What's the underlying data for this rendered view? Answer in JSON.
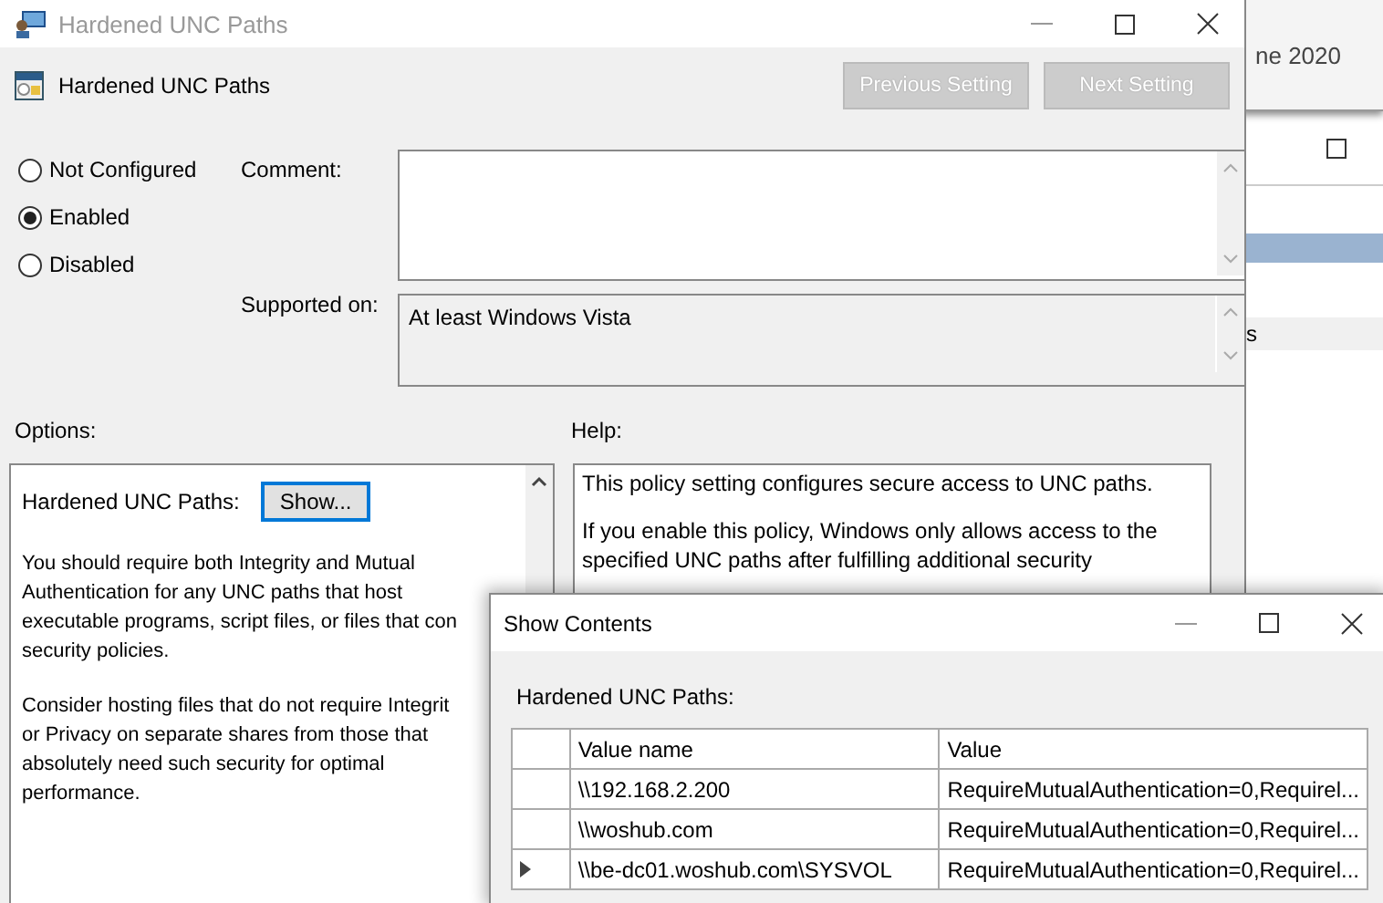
{
  "background_window": {
    "date_text": "ne 2020",
    "side_text": "s"
  },
  "window": {
    "title": "Hardened UNC Paths"
  },
  "header": {
    "title": "Hardened UNC Paths",
    "buttons": [
      {
        "label": "Previous Setting",
        "disabled": true
      },
      {
        "label": "Next Setting",
        "disabled": true
      }
    ]
  },
  "state_options": [
    {
      "label": "Not Configured",
      "selected": false
    },
    {
      "label": "Enabled",
      "selected": true
    },
    {
      "label": "Disabled",
      "selected": false
    }
  ],
  "comment": {
    "label": "Comment:"
  },
  "supported_on": {
    "label": "Supported on:",
    "value": "At least Windows Vista"
  },
  "options": {
    "label": "Options:",
    "field_label": "Hardened UNC Paths:",
    "button": "Show...",
    "paragraphs": [
      [
        "You should require both Integrity and Mutual",
        "Authentication for any UNC paths that host",
        "executable programs, script files, or files that con",
        "security policies."
      ],
      [
        "Consider hosting files that do not require Integrit",
        "or Privacy on separate shares from those that",
        "absolutely need such security for optimal",
        "performance."
      ]
    ]
  },
  "help": {
    "label": "Help:",
    "paragraphs": [
      [
        "This policy setting configures secure access to UNC paths."
      ],
      [
        "If you enable this policy, Windows only allows access to the",
        "specified UNC paths after fulfilling additional security"
      ]
    ]
  },
  "show_contents": {
    "title": "Show Contents",
    "label": "Hardened UNC Paths:",
    "columns": [
      "Value name",
      "Value"
    ],
    "rows": [
      {
        "name": "\\\\192.168.2.200",
        "value": "RequireMutualAuthentication=0,Requirel...",
        "selected": false
      },
      {
        "name": "\\\\woshub.com",
        "value": "RequireMutualAuthentication=0,Requirel...",
        "selected": false
      },
      {
        "name": "\\\\be-dc01.woshub.com\\SYSVOL",
        "value": "RequireMutualAuthentication=0,Requirel...",
        "selected": true
      }
    ]
  }
}
